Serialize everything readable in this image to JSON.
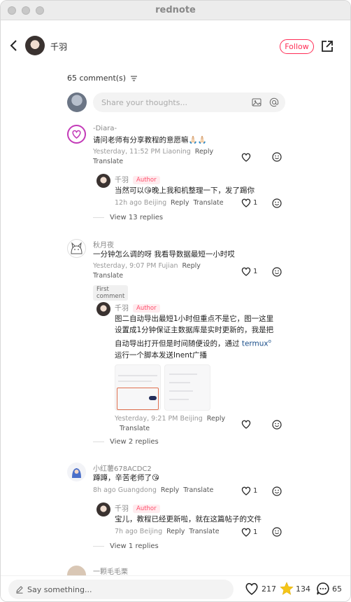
{
  "window": {
    "title": "rednote"
  },
  "header": {
    "username": "千羽",
    "follow_label": "Follow"
  },
  "comments_header": {
    "count_label": "65 comment(s)"
  },
  "input": {
    "placeholder": "Share your thoughts..."
  },
  "comments": [
    {
      "name": "-Diara-",
      "text": "请问老师有分享教程的意愿嘛🙏🏻🙏🏻",
      "meta": "Yesterday, 11:52 PM Liaoning",
      "reply": "Reply",
      "translate": "Translate",
      "sub": {
        "name": "千羽",
        "author": "Author",
        "text": "当然可以😘晚上我和机整理一下，发了踢你",
        "meta": "12h ago Beijing",
        "reply": "Reply",
        "translate": "Translate",
        "likes": "1"
      },
      "view_replies": "View 13 replies"
    },
    {
      "name": "秋月夜",
      "text": "一分钟怎么调的呀 我看导数据最短一小时哎",
      "meta": "Yesterday, 9:07 PM Fujian",
      "reply": "Reply",
      "translate": "Translate",
      "likes": "1",
      "badge": "First comment",
      "sub": {
        "name": "千羽",
        "author": "Author",
        "text1": "图二自动导出最短1小时但重点不是它，图一这里",
        "text2": "设置成1分钟保证主数据库是实时更新的，我是把",
        "text3": "自动导出打开但是时间随便设的，通过 ",
        "link": "termux",
        "text4": "运行一个脚本发送Inent广播",
        "meta": "Yesterday, 9:21 PM Beijing",
        "reply": "Reply",
        "translate": "Translate"
      },
      "view_replies": "View 2 replies"
    },
    {
      "name": "小红薯678ACDC2",
      "text": "蹲蹲，辛苦老师了😘",
      "meta": "8h ago Guangdong",
      "reply": "Reply",
      "translate": "Translate",
      "likes": "1",
      "sub": {
        "name": "千羽",
        "author": "Author",
        "text": "宝儿，教程已经更新啦，就在这篇帖子的文件",
        "meta": "7h ago Beijing",
        "reply": "Reply",
        "translate": "Translate",
        "likes": "1"
      },
      "view_replies": "View 1 replies"
    },
    {
      "name": "一颗毛毛栗"
    }
  ],
  "bottom": {
    "say_placeholder": "Say something...",
    "likes": "217",
    "stars": "134",
    "comments": "65"
  },
  "colors": {
    "accent": "#ff2d55",
    "star": "#f5c518"
  }
}
